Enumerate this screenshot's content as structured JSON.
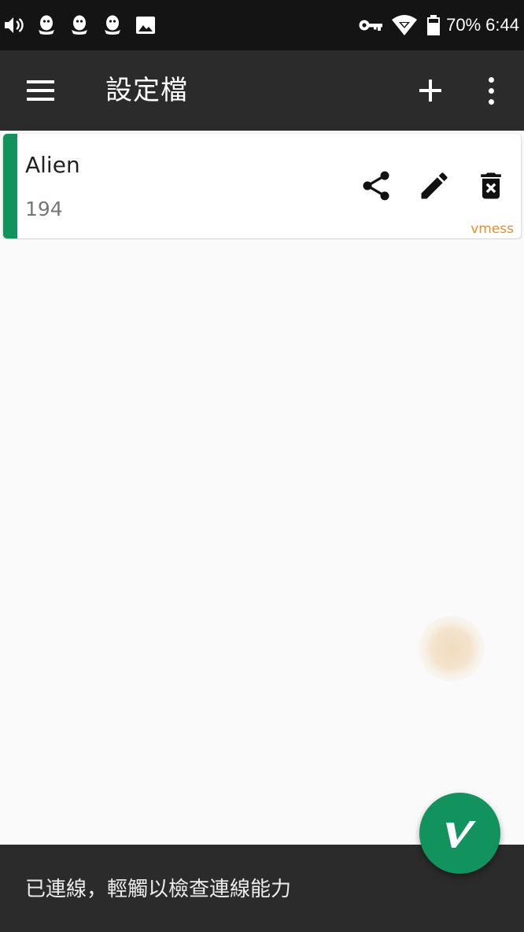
{
  "status_bar": {
    "left_icons": [
      "volume-icon",
      "qq-icon",
      "qq-icon",
      "qq-icon",
      "image-icon"
    ],
    "right_icons": [
      "vpn-key-icon",
      "wifi-icon",
      "battery-icon"
    ],
    "battery_level": "70%",
    "time": "6:44"
  },
  "app_bar": {
    "title": "設定檔",
    "menu_icon": "menu-icon",
    "add_icon": "plus-icon",
    "more_icon": "more-vertical-icon"
  },
  "servers": [
    {
      "name": "Alien",
      "address": "194",
      "type": "vmess",
      "actions": [
        "share-icon",
        "edit-icon",
        "delete-icon"
      ]
    }
  ],
  "bottom": {
    "status_text": "已連線，輕觸以檢查連線能力"
  },
  "fab": {
    "icon": "v-logo-icon"
  },
  "colors": {
    "status_bar_bg": "#141414",
    "app_bar_bg": "#2b2b2b",
    "accent": "#12935e",
    "page_bg": "#fafafa",
    "type_label": "#ef8a26",
    "secondary_text": "#777777"
  }
}
